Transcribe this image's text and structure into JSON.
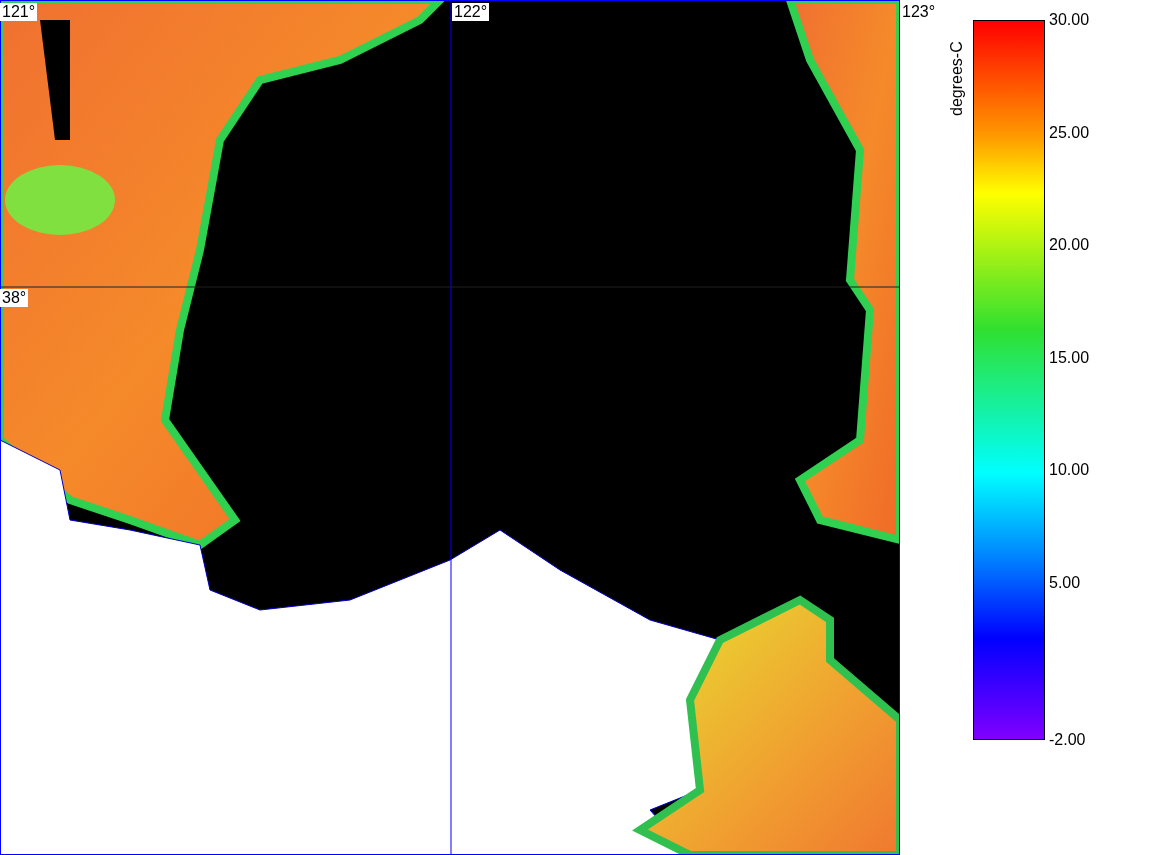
{
  "map": {
    "longitude_labels": [
      "121°",
      "122°",
      "123°"
    ],
    "latitude_labels": [
      "38°"
    ]
  },
  "legend": {
    "title": "degrees-C",
    "ticks": [
      "30.00",
      "25.00",
      "20.00",
      "15.00",
      "10.00",
      "5.00",
      "-2.00"
    ]
  }
}
